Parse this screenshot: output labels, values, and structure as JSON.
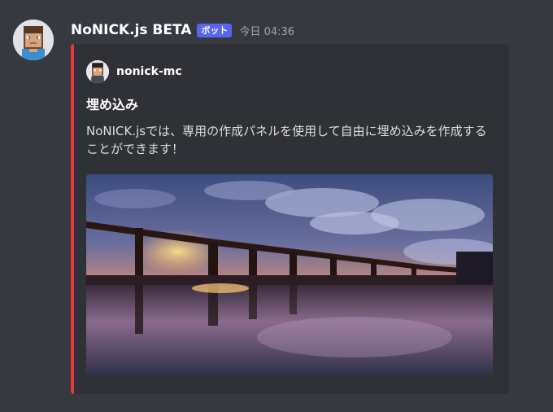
{
  "message": {
    "username": "NoNICK.js BETA",
    "bot_badge": "ボット",
    "timestamp": "今日 04:36",
    "avatar_icon": "minecraft-skin-avatar"
  },
  "embed": {
    "accent_color": "#e03a3e",
    "author": {
      "name": "nonick-mc",
      "avatar_icon": "minecraft-skin-avatar"
    },
    "title": "埋め込み",
    "description": "NoNICK.jsでは、専用の作成パネルを使用して自由に埋め込みを作成することができます！",
    "image": "sunset-bridge-over-water"
  }
}
